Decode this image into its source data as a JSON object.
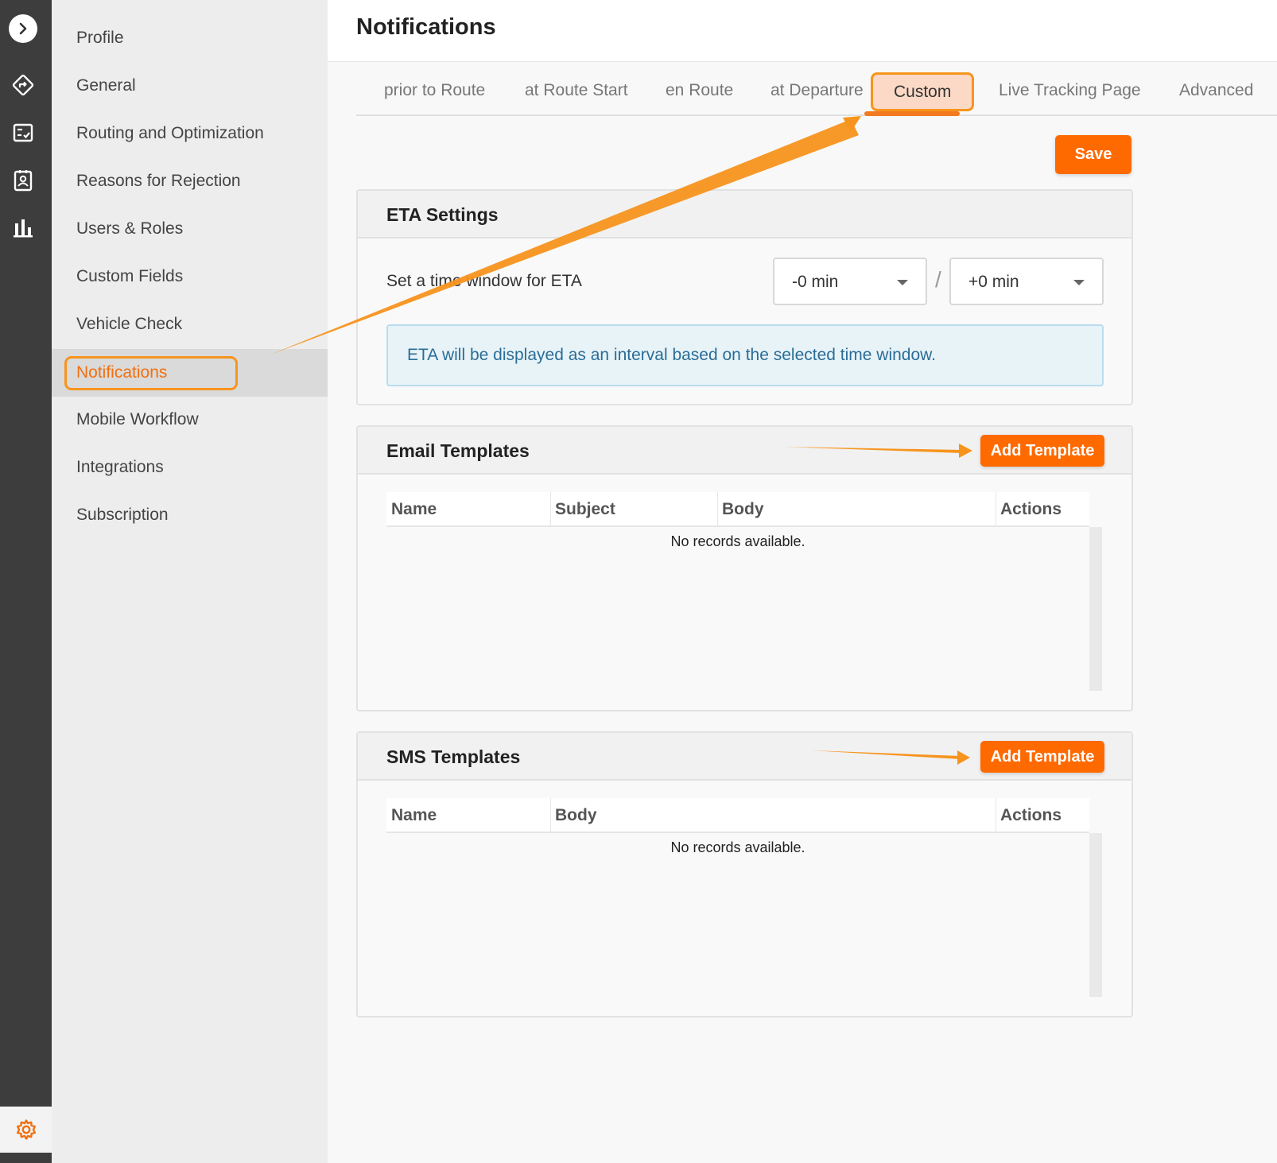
{
  "rail": {
    "icons": [
      "chevron-right-icon",
      "route-icon",
      "checklist-icon",
      "contact-card-icon",
      "bar-chart-icon",
      "gear-icon"
    ]
  },
  "sidebar": {
    "items": [
      {
        "label": "Profile"
      },
      {
        "label": "General"
      },
      {
        "label": "Routing and Optimization"
      },
      {
        "label": "Reasons for Rejection"
      },
      {
        "label": "Users & Roles"
      },
      {
        "label": "Custom Fields"
      },
      {
        "label": "Vehicle Check"
      },
      {
        "label": "Notifications"
      },
      {
        "label": "Mobile Workflow"
      },
      {
        "label": "Integrations"
      },
      {
        "label": "Subscription"
      }
    ],
    "active": "Notifications"
  },
  "header": {
    "title": "Notifications"
  },
  "tabs": [
    {
      "label": "prior to Route"
    },
    {
      "label": "at Route Start"
    },
    {
      "label": "en Route"
    },
    {
      "label": "at Departure"
    },
    {
      "label": "Custom"
    },
    {
      "label": "Live Tracking Page"
    },
    {
      "label": "Advanced"
    }
  ],
  "active_tab": "Custom",
  "save_label": "Save",
  "eta": {
    "title": "ETA Settings",
    "label": "Set a time window for ETA",
    "before_value": "-0 min",
    "after_value": "+0 min",
    "separator": "/",
    "info": "ETA will be displayed as an interval based on the selected time window."
  },
  "email_templates": {
    "title": "Email Templates",
    "add_label": "Add Template",
    "columns": [
      "Name",
      "Subject",
      "Body",
      "Actions"
    ],
    "empty": "No records available."
  },
  "sms_templates": {
    "title": "SMS Templates",
    "add_label": "Add Template",
    "columns": [
      "Name",
      "Body",
      "Actions"
    ],
    "empty": "No records available."
  },
  "colors": {
    "accent": "#ff6a00",
    "annotation": "#f7941d",
    "rail": "#3d3d3d",
    "info_text": "#2a6d96"
  }
}
